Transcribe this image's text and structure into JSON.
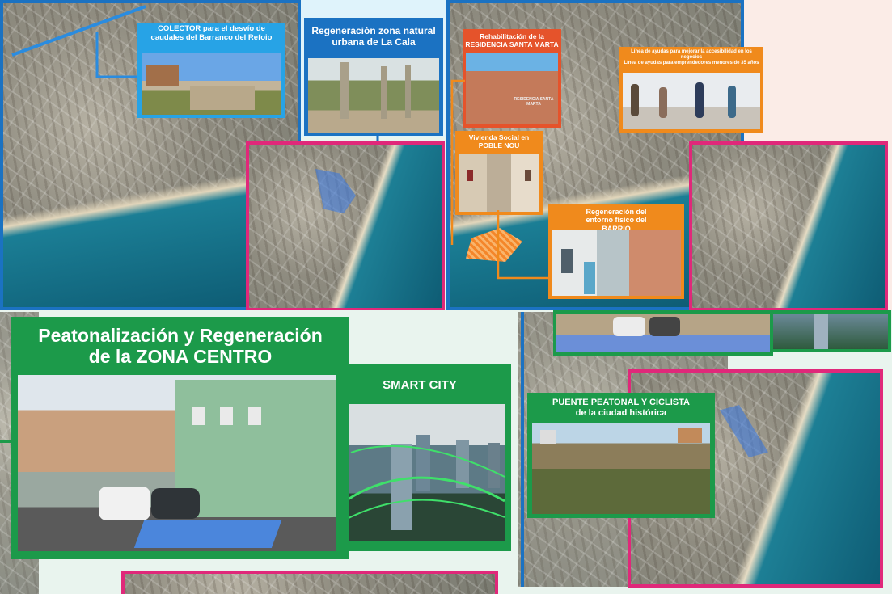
{
  "colors": {
    "blue": "#1b72c2",
    "pink": "#e0287a",
    "orange": "#f08a1c",
    "green": "#1c9a4a",
    "light_green_bg": "#e9f4ee"
  },
  "panels": {
    "colector": {
      "title": "COLECTOR para el desvío de caudales del Barranco del Refoio"
    },
    "la_cala": {
      "title": "Regeneración zona natural urbana de La Cala"
    },
    "santa_marta": {
      "title_line1": "Rehabilitación de la",
      "title_line2": "RESIDENCIA SANTA MARTA",
      "sign_text": "RESIDENCIA SANTA MARTA"
    },
    "ayudas": {
      "line1": "Línea de ayudas para mejorar la accesibilidad en los negocios",
      "line2": "Línea de ayudas para emprendedores menores de 35 años"
    },
    "vivienda": {
      "title": "Vivienda Social en POBLE NOU"
    },
    "barrio": {
      "title": "Regeneración del entorno físico del BARRIO"
    },
    "zona_centro": {
      "title_line1": "Peatonalización y Regeneración",
      "title_line2": "de la ZONA CENTRO"
    },
    "smart_city": {
      "title": "SMART CITY"
    },
    "puente": {
      "title_line1": "PUENTE PEATONAL Y CICLISTA",
      "title_line2": "de la ciudad histórica"
    }
  },
  "icons": [
    "accessibility-parking-icon"
  ]
}
